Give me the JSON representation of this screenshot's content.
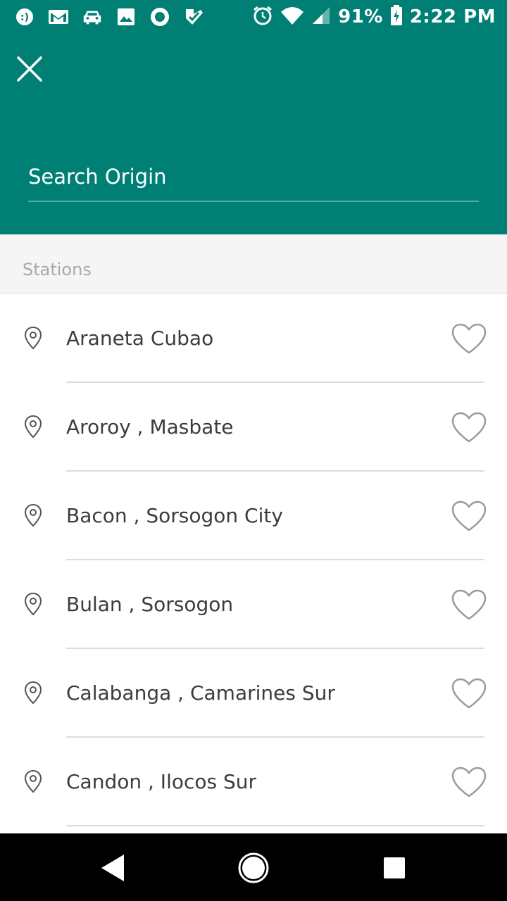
{
  "status_bar": {
    "battery": "91%",
    "time": "2:22 PM",
    "left_icons": [
      "message-icon",
      "gmail-icon",
      "car-icon",
      "photo-icon",
      "record-icon",
      "check-icon"
    ],
    "right_icons": [
      "alarm-icon",
      "wifi-icon",
      "signal-icon",
      "battery-charging-icon"
    ]
  },
  "header": {
    "close_icon": "close-icon",
    "search_placeholder": "Search Origin",
    "background_color": "#008075"
  },
  "section": {
    "title": "Stations"
  },
  "stations": [
    {
      "label": "Araneta Cubao"
    },
    {
      "label": "Aroroy , Masbate"
    },
    {
      "label": "Bacon , Sorsogon City"
    },
    {
      "label": "Bulan , Sorsogon"
    },
    {
      "label": "Calabanga , Camarines Sur"
    },
    {
      "label": "Candon , Ilocos Sur"
    }
  ],
  "nav_bar": {
    "back_icon": "back-icon",
    "home_icon": "home-icon",
    "recents_icon": "recents-icon"
  }
}
